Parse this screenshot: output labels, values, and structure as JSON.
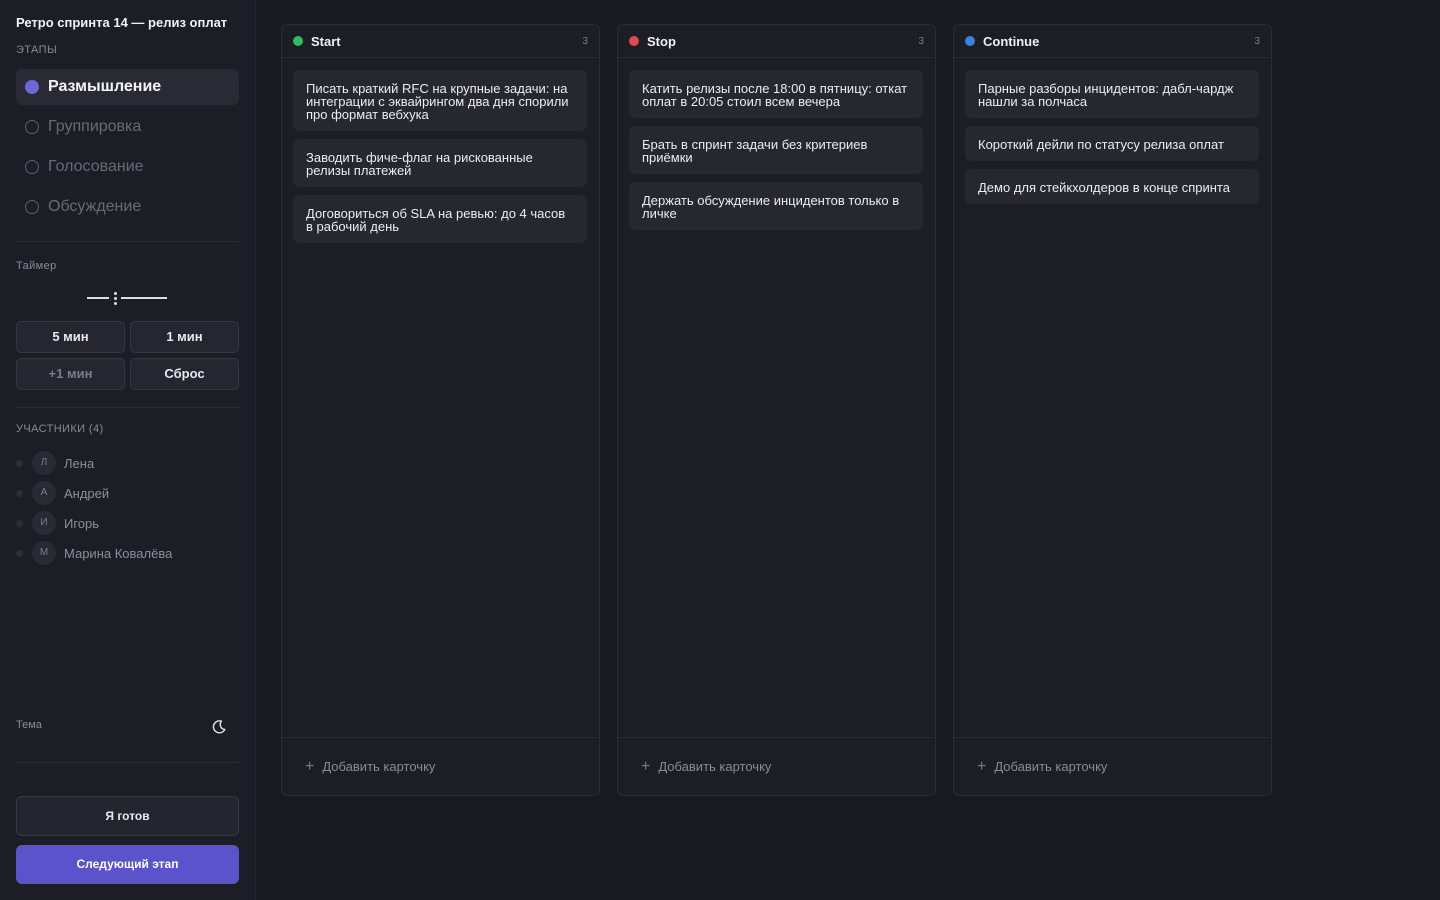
{
  "board": {
    "title": "Ретро спринта 14 — релиз оплат"
  },
  "stages": {
    "caption": "ЭТАПЫ",
    "items": [
      {
        "label": "Размышление",
        "active": true
      },
      {
        "label": "Группировка",
        "active": false
      },
      {
        "label": "Голосование",
        "active": false
      },
      {
        "label": "Обсуждение",
        "active": false
      }
    ]
  },
  "timer": {
    "caption": "Таймер",
    "buttons": [
      "5 мин",
      "1 мин",
      "+1 мин",
      "Сброс"
    ]
  },
  "participants": {
    "caption": "УЧАСТНИКИ (4)",
    "items": [
      {
        "initial": "Л",
        "name": "Лена"
      },
      {
        "initial": "А",
        "name": "Андрей"
      },
      {
        "initial": "И",
        "name": "Игорь"
      },
      {
        "initial": "М",
        "name": "Марина Ковалёва"
      }
    ]
  },
  "theme": {
    "label": "Тема",
    "icon": "moon-icon"
  },
  "actions": {
    "ready": "Я готов",
    "next": "Следующий этап"
  },
  "colors": {
    "start": "#2fbe5b",
    "stop": "#e5484d",
    "continue": "#3b7fe0",
    "accent": "#5a53cb"
  },
  "columns": [
    {
      "title": "Start",
      "count": "3",
      "cards": [
        "Писать краткий RFC на крупные задачи: на интеграции с эквайрингом два дня спорили про формат вебхука",
        "Заводить фиче-флаг на рискованные релизы платежей",
        "Договориться об SLA на ревью: до 4 часов в рабочий день"
      ],
      "add_label": "Добавить карточку"
    },
    {
      "title": "Stop",
      "count": "3",
      "cards": [
        "Катить релизы после 18:00 в пятницу: откат оплат в 20:05 стоил всем вечера",
        "Брать в спринт задачи без критериев приёмки",
        "Держать обсуждение инцидентов только в личке"
      ],
      "add_label": "Добавить карточку"
    },
    {
      "title": "Continue",
      "count": "3",
      "cards": [
        "Парные разборы инцидентов: дабл-чардж нашли за полчаса",
        "Короткий дейли по статусу релиза оплат",
        "Демо для стейкхолдеров в конце спринта"
      ],
      "add_label": "Добавить карточку"
    }
  ]
}
